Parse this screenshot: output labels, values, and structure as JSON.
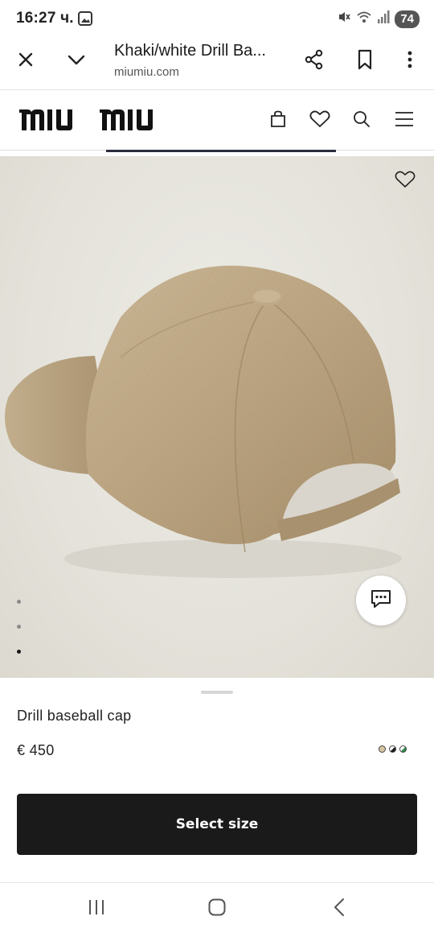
{
  "status_bar": {
    "time": "16:27 ч.",
    "battery": "74",
    "icons": [
      "gallery-icon",
      "mute-icon",
      "wifi-icon",
      "signal-icon",
      "battery-icon"
    ]
  },
  "browser": {
    "tab_title": "Khaki/white Drill Ba...",
    "url": "miumiu.com",
    "icons": [
      "close-icon",
      "chevron-down-icon",
      "share-icon",
      "bookmark-icon",
      "more-vert-icon"
    ]
  },
  "site": {
    "logo_text": "miu miu",
    "header_icons": [
      "bag-icon",
      "heart-icon",
      "search-icon",
      "menu-icon"
    ]
  },
  "gallery": {
    "dots": [
      {
        "active": false
      },
      {
        "active": false
      },
      {
        "active": true
      }
    ],
    "wishlist_icon": "heart-icon",
    "chat_icon": "chat-icon"
  },
  "product": {
    "name": "Drill baseball cap",
    "price": "€ 450",
    "swatches": [
      {
        "color": "#d8c4a0"
      },
      {
        "color": "#ffffff",
        "half": "#1a1a1a"
      },
      {
        "color": "#ffffff",
        "half": "#2f8a4a"
      }
    ],
    "cta_label": "Select size"
  },
  "colors": {
    "accent": "#1a1a1a",
    "cap": "#bba584",
    "image_bg": "#e6e4dd"
  }
}
